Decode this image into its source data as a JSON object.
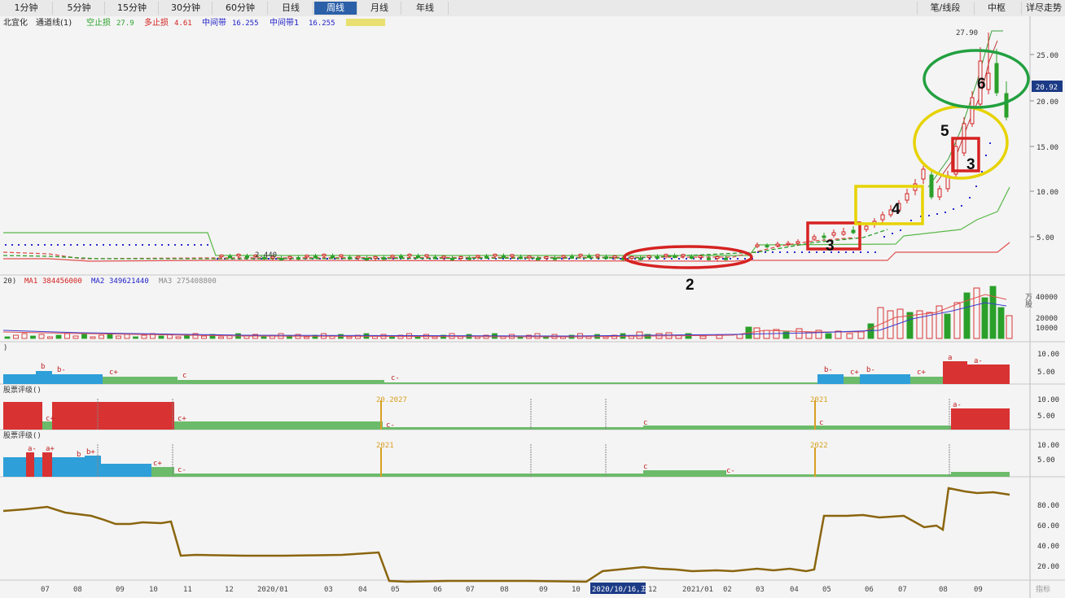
{
  "toolbar": {
    "tabs": [
      "1分钟",
      "5分钟",
      "15分钟",
      "30分钟",
      "60分钟",
      "日线",
      "周线",
      "月线",
      "年线"
    ],
    "active_tab": 6,
    "right_tabs": [
      "笔/线段",
      "中枢",
      "详尽走势"
    ]
  },
  "price_panel": {
    "stock_name": "北宜化",
    "indicator": "通道线(1)",
    "legend": [
      {
        "label": "空止损",
        "value": "27.9",
        "color": "#2aa02a"
      },
      {
        "label": "多止损",
        "value": "4.61",
        "color": "#d42020"
      },
      {
        "label": "中间带",
        "value": "16.255",
        "color": "#2020c8"
      },
      {
        "label": "中间带1",
        "value": "16.255",
        "color": "#2020c8"
      }
    ],
    "max_price_label": "27.90",
    "current_price": "20.92",
    "axis_labels": [
      "25.00",
      "20.00",
      "15.00",
      "10.00",
      "5.00"
    ],
    "low_price_label": "2.440"
  },
  "annotations": {
    "n2": "2",
    "n3a": "3",
    "n4": "4",
    "n5": "5",
    "n3b": "3",
    "n6": "6"
  },
  "volume_panel": {
    "prefix": "20)",
    "ma1_label": "MA1",
    "ma1_value": "384456000",
    "ma2_label": "MA2",
    "ma2_value": "349621440",
    "ma3_label": "MA3",
    "ma3_value": "275408800",
    "axis_labels": [
      "40000",
      "20000",
      "10000"
    ],
    "unit": "万股"
  },
  "rating_panel_1": {
    "title": ")",
    "axis_labels": [
      "10.00",
      "5.00"
    ],
    "marks": [
      "b",
      "b-",
      "c+",
      "c",
      "c-",
      "b-",
      "c+",
      "b-",
      "c+",
      "a",
      "a-"
    ]
  },
  "rating_panel_2": {
    "title": "股票评级()",
    "axis_labels": [
      "10.00",
      "5.00"
    ],
    "marks": [
      "c+",
      "c+",
      "c-",
      "c",
      "c",
      "a-"
    ],
    "dates": [
      "20.2027",
      "2021"
    ]
  },
  "rating_panel_3": {
    "title": "股票评级()",
    "axis_labels": [
      "10.00",
      "5.00"
    ],
    "marks": [
      "a-",
      "a+",
      "b",
      "b+",
      "c+",
      "c-",
      "c",
      "c-"
    ],
    "dates": [
      "2021",
      "2022"
    ]
  },
  "oscillator_panel": {
    "axis_labels": [
      "80.00",
      "60.00",
      "40.00",
      "20.00"
    ]
  },
  "time_axis": {
    "labels": [
      "07",
      "08",
      "09",
      "10",
      "11",
      "12",
      "2020/01",
      "03",
      "04",
      "05",
      "06",
      "07",
      "08",
      "09",
      "10",
      "12",
      "2021/01",
      "02",
      "03",
      "04",
      "05",
      "06",
      "07",
      "08",
      "09"
    ],
    "cursor_label": "2020/10/16,五",
    "corner_label": "指标"
  }
}
